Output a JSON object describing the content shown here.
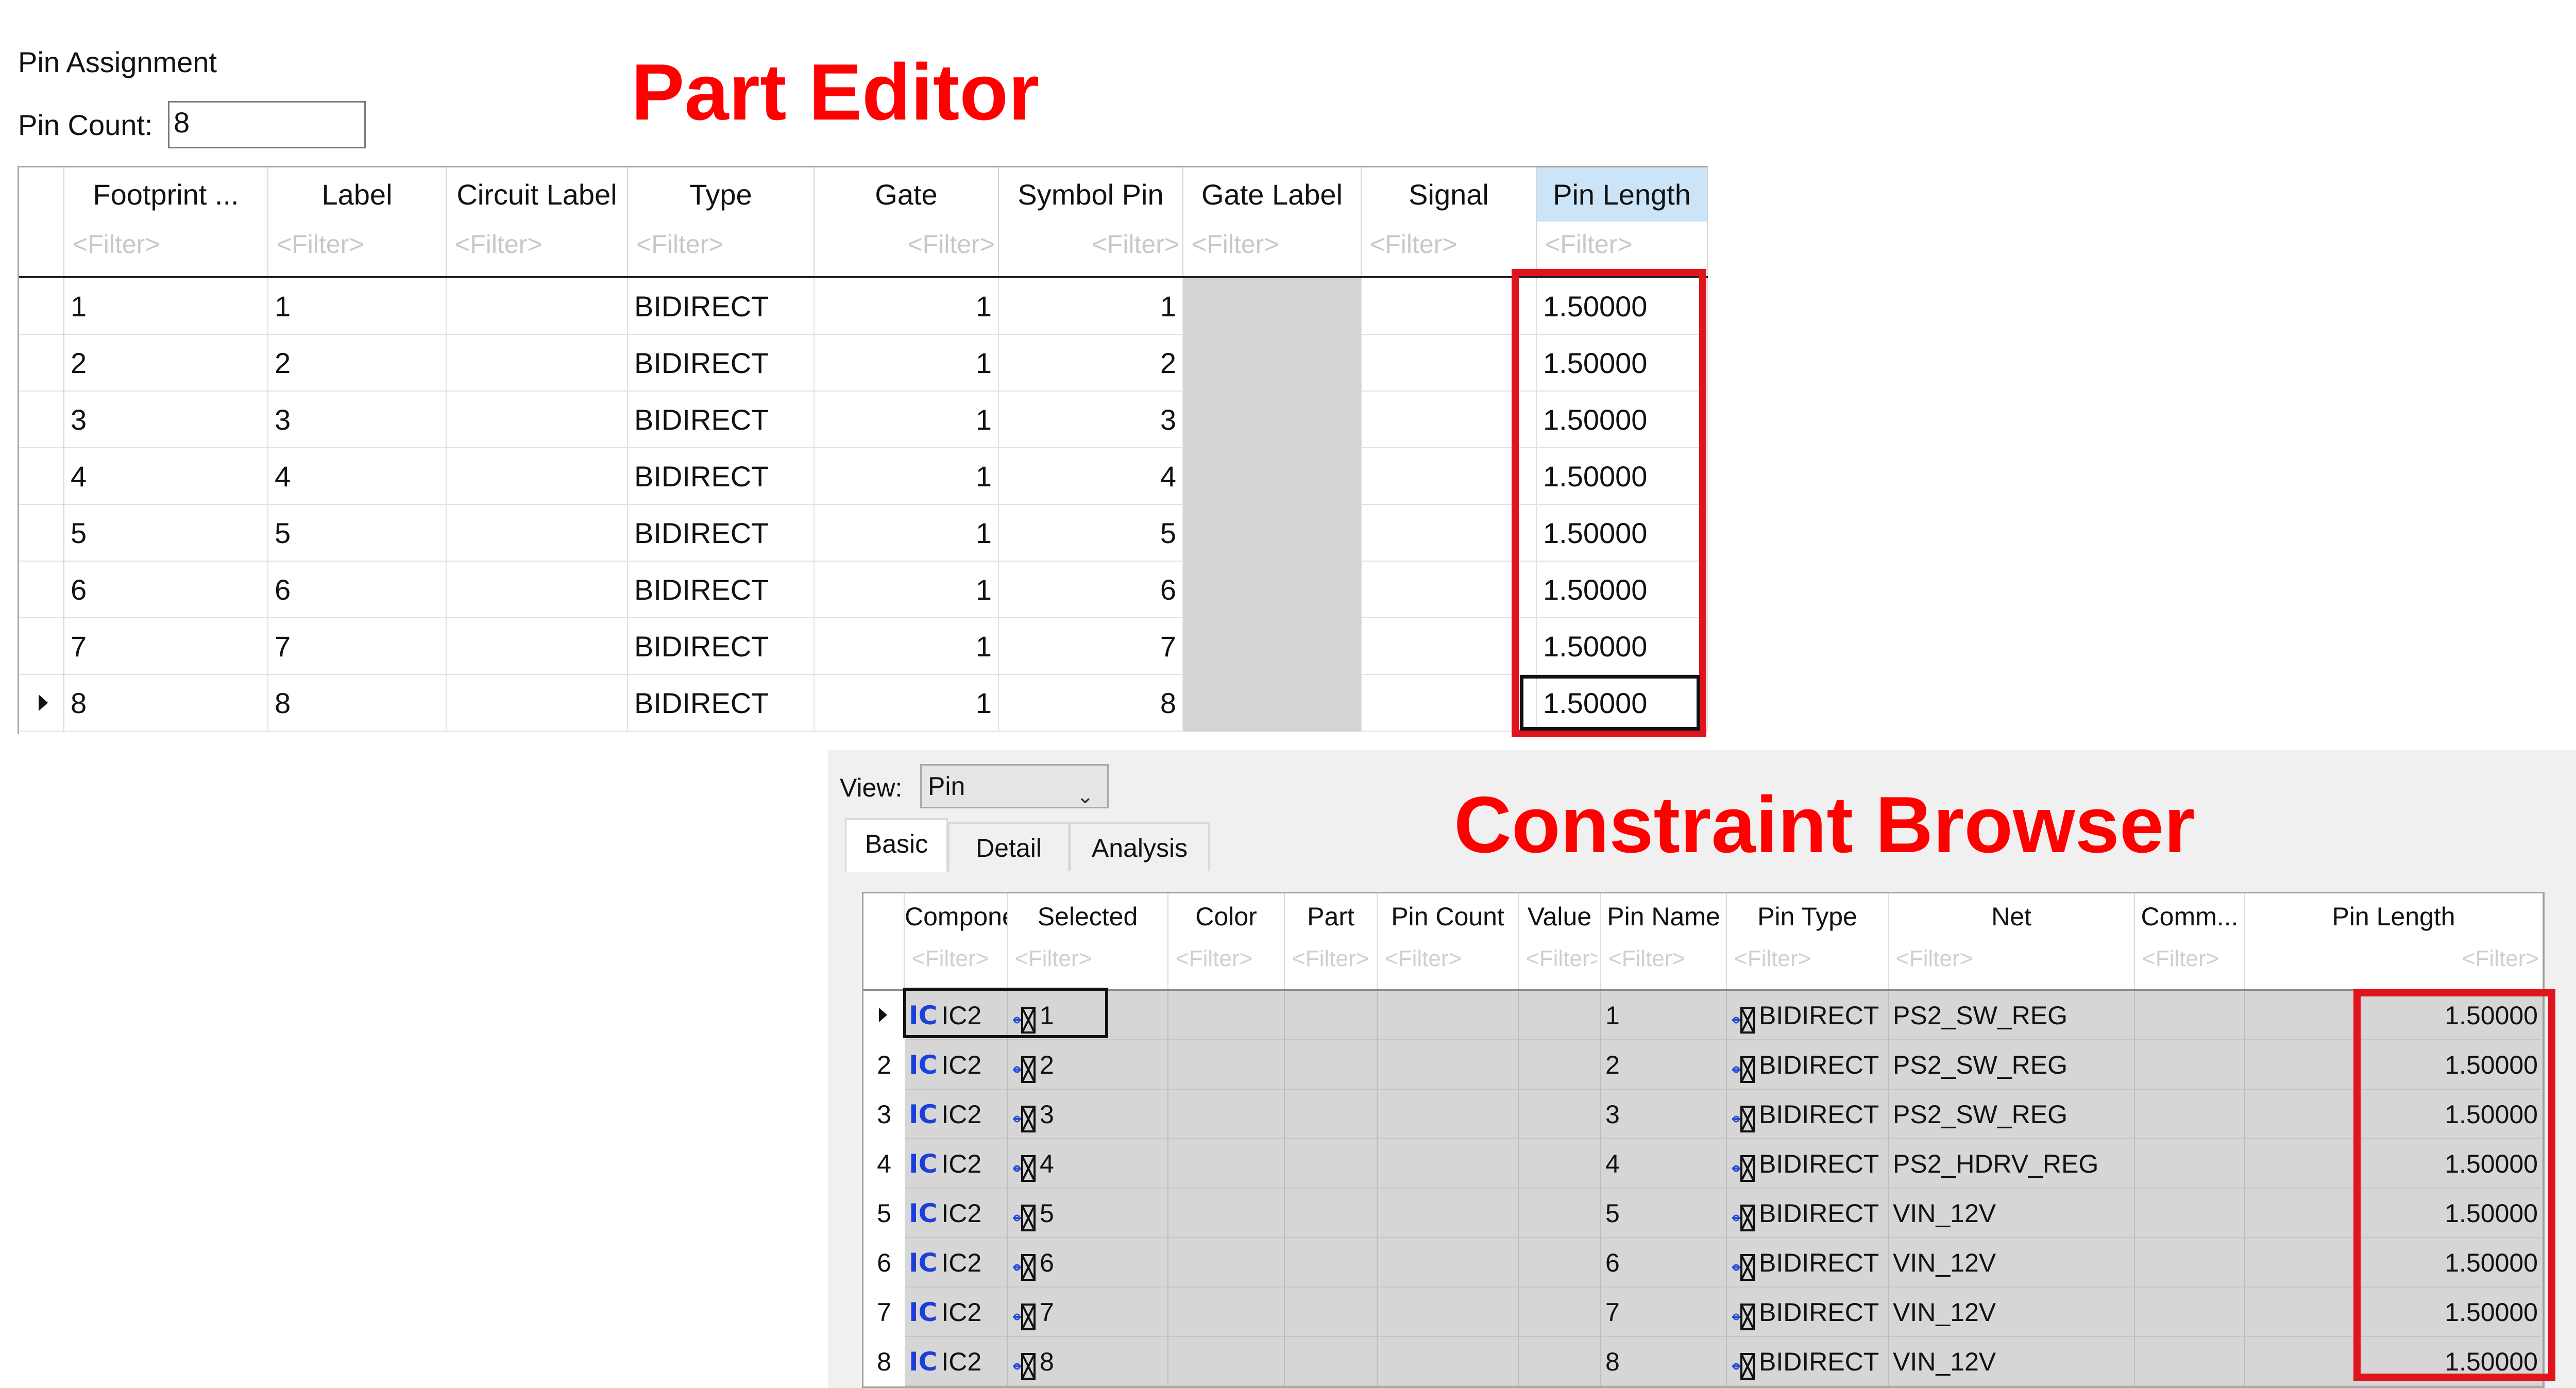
{
  "part_editor": {
    "section_title": "Pin Assignment",
    "pin_count_label": "Pin Count:",
    "pin_count_value": "8",
    "annotation_title": "Part Editor",
    "annotation_color": "#ff0000",
    "filter_placeholder": "<Filter>",
    "columns": [
      "Footprint ...",
      "Label",
      "Circuit Label",
      "Type",
      "Gate",
      "Symbol Pin",
      "Gate Label",
      "Signal",
      "Pin Length"
    ],
    "selected_column": "Pin Length",
    "rows": [
      {
        "footprint": "1",
        "label": "1",
        "circuit_label": "",
        "type": "BIDIRECT",
        "gate": "1",
        "symbol_pin": "1",
        "gate_label": "",
        "signal": "",
        "pin_length": "1.50000"
      },
      {
        "footprint": "2",
        "label": "2",
        "circuit_label": "",
        "type": "BIDIRECT",
        "gate": "1",
        "symbol_pin": "2",
        "gate_label": "",
        "signal": "",
        "pin_length": "1.50000"
      },
      {
        "footprint": "3",
        "label": "3",
        "circuit_label": "",
        "type": "BIDIRECT",
        "gate": "1",
        "symbol_pin": "3",
        "gate_label": "",
        "signal": "",
        "pin_length": "1.50000"
      },
      {
        "footprint": "4",
        "label": "4",
        "circuit_label": "",
        "type": "BIDIRECT",
        "gate": "1",
        "symbol_pin": "4",
        "gate_label": "",
        "signal": "",
        "pin_length": "1.50000"
      },
      {
        "footprint": "5",
        "label": "5",
        "circuit_label": "",
        "type": "BIDIRECT",
        "gate": "1",
        "symbol_pin": "5",
        "gate_label": "",
        "signal": "",
        "pin_length": "1.50000"
      },
      {
        "footprint": "6",
        "label": "6",
        "circuit_label": "",
        "type": "BIDIRECT",
        "gate": "1",
        "symbol_pin": "6",
        "gate_label": "",
        "signal": "",
        "pin_length": "1.50000"
      },
      {
        "footprint": "7",
        "label": "7",
        "circuit_label": "",
        "type": "BIDIRECT",
        "gate": "1",
        "symbol_pin": "7",
        "gate_label": "",
        "signal": "",
        "pin_length": "1.50000"
      },
      {
        "footprint": "8",
        "label": "8",
        "circuit_label": "",
        "type": "BIDIRECT",
        "gate": "1",
        "symbol_pin": "8",
        "gate_label": "",
        "signal": "",
        "pin_length": "1.50000"
      }
    ],
    "current_row": 8
  },
  "constraint_browser": {
    "view_label": "View:",
    "view_value": "Pin",
    "annotation_title": "Constraint Browser",
    "annotation_color": "#ff0000",
    "tabs": [
      "Basic",
      "Detail",
      "Analysis"
    ],
    "active_tab": "Basic",
    "filter_placeholder": "<Filter>",
    "columns": [
      "Component",
      "Selected",
      "Color",
      "Part",
      "Pin Count",
      "Value",
      "Pin Name",
      "Pin Type",
      "Net",
      "Comm...",
      "Pin Length"
    ],
    "component_icon": "ic-chip-icon",
    "pin_icon": "pin-icon",
    "rows": [
      {
        "row_header": "",
        "component": "IC2",
        "selected": "1",
        "color": "",
        "part": "",
        "pin_count": "",
        "value": "",
        "pin_name": "1",
        "pin_type": "BIDIRECT",
        "net": "PS2_SW_REG",
        "comment": "",
        "pin_length": "1.50000"
      },
      {
        "row_header": "2",
        "component": "IC2",
        "selected": "2",
        "color": "",
        "part": "",
        "pin_count": "",
        "value": "",
        "pin_name": "2",
        "pin_type": "BIDIRECT",
        "net": "PS2_SW_REG",
        "comment": "",
        "pin_length": "1.50000"
      },
      {
        "row_header": "3",
        "component": "IC2",
        "selected": "3",
        "color": "",
        "part": "",
        "pin_count": "",
        "value": "",
        "pin_name": "3",
        "pin_type": "BIDIRECT",
        "net": "PS2_SW_REG",
        "comment": "",
        "pin_length": "1.50000"
      },
      {
        "row_header": "4",
        "component": "IC2",
        "selected": "4",
        "color": "",
        "part": "",
        "pin_count": "",
        "value": "",
        "pin_name": "4",
        "pin_type": "BIDIRECT",
        "net": "PS2_HDRV_REG",
        "comment": "",
        "pin_length": "1.50000"
      },
      {
        "row_header": "5",
        "component": "IC2",
        "selected": "5",
        "color": "",
        "part": "",
        "pin_count": "",
        "value": "",
        "pin_name": "5",
        "pin_type": "BIDIRECT",
        "net": "VIN_12V",
        "comment": "",
        "pin_length": "1.50000"
      },
      {
        "row_header": "6",
        "component": "IC2",
        "selected": "6",
        "color": "",
        "part": "",
        "pin_count": "",
        "value": "",
        "pin_name": "6",
        "pin_type": "BIDIRECT",
        "net": "VIN_12V",
        "comment": "",
        "pin_length": "1.50000"
      },
      {
        "row_header": "7",
        "component": "IC2",
        "selected": "7",
        "color": "",
        "part": "",
        "pin_count": "",
        "value": "",
        "pin_name": "7",
        "pin_type": "BIDIRECT",
        "net": "VIN_12V",
        "comment": "",
        "pin_length": "1.50000"
      },
      {
        "row_header": "8",
        "component": "IC2",
        "selected": "8",
        "color": "",
        "part": "",
        "pin_count": "",
        "value": "",
        "pin_name": "8",
        "pin_type": "BIDIRECT",
        "net": "VIN_12V",
        "comment": "",
        "pin_length": "1.50000"
      }
    ],
    "current_row": 1
  }
}
